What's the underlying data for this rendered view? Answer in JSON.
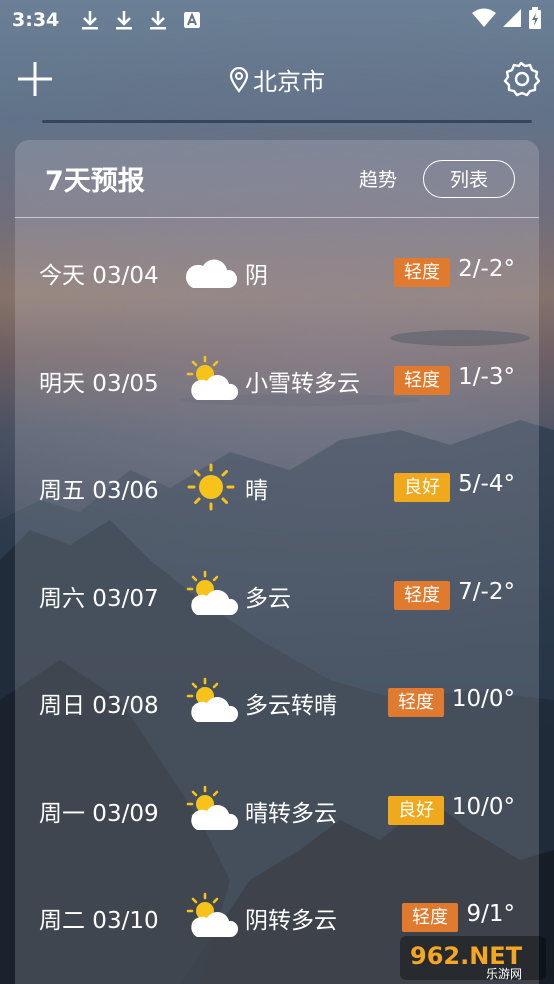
{
  "status_bar": {
    "time": "3:34",
    "left_icons": [
      "download-icon",
      "download-icon",
      "download-icon",
      "a-icon"
    ],
    "right_icons": [
      "wifi-icon",
      "signal-icon",
      "battery-icon"
    ]
  },
  "topbar": {
    "location": "北京市"
  },
  "forecast": {
    "title": "7天预报",
    "trend_label": "趋势",
    "list_label": "列表",
    "days": [
      {
        "date": "今天 03/04",
        "icon": "cloudy-icon",
        "desc": "阴",
        "aqi": "轻度",
        "aqi_color": "#e07a2e",
        "temp": "2/-2°"
      },
      {
        "date": "明天 03/05",
        "icon": "partly-cloudy-icon",
        "desc": "小雪转多云",
        "aqi": "轻度",
        "aqi_color": "#e07a2e",
        "temp": "1/-3°"
      },
      {
        "date": "周五 03/06",
        "icon": "sunny-icon",
        "desc": "晴",
        "aqi": "良好",
        "aqi_color": "#f0a81c",
        "temp": "5/-4°"
      },
      {
        "date": "周六 03/07",
        "icon": "partly-cloudy-icon",
        "desc": "多云",
        "aqi": "轻度",
        "aqi_color": "#e07a2e",
        "temp": "7/-2°"
      },
      {
        "date": "周日 03/08",
        "icon": "partly-cloudy-icon",
        "desc": "多云转晴",
        "aqi": "轻度",
        "aqi_color": "#e07a2e",
        "temp": "10/0°"
      },
      {
        "date": "周一 03/09",
        "icon": "partly-cloudy-icon",
        "desc": "晴转多云",
        "aqi": "良好",
        "aqi_color": "#f0a81c",
        "temp": "10/0°"
      },
      {
        "date": "周二 03/10",
        "icon": "partly-cloudy-icon",
        "desc": "阴转多云",
        "aqi": "轻度",
        "aqi_color": "#e07a2e",
        "temp": "9/1°"
      }
    ]
  },
  "watermark": {
    "brand": "962.NET",
    "sub": "乐游网"
  }
}
